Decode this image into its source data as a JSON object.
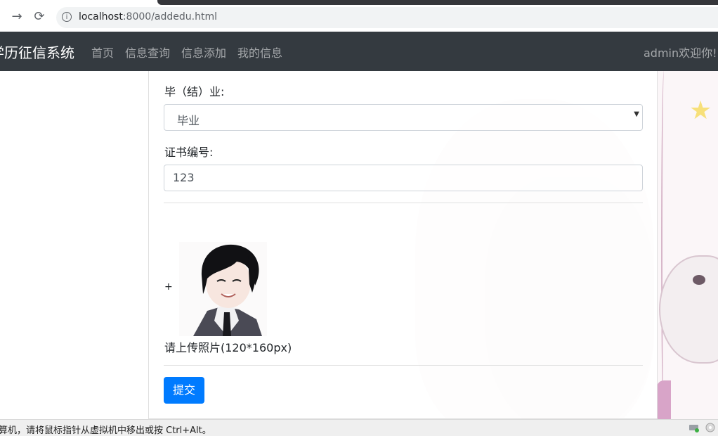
{
  "browser": {
    "url_host": "localhost",
    "url_path": ":8000/addedu.html",
    "back_icon": "arrow-right-icon",
    "reload_icon": "reload-icon"
  },
  "navbar": {
    "brand": "学历征信系统",
    "links": [
      "首页",
      "信息查询",
      "信息添加",
      "我的信息"
    ],
    "welcome": "admin欢迎你! 退"
  },
  "form": {
    "graduation_label": "毕（结）业:",
    "graduation_value": "毕业",
    "cert_label": "证书编号:",
    "cert_value": "123",
    "plus": "+",
    "upload_hint": "请上传照片(120*160px)",
    "submit": "提交"
  },
  "status": {
    "text": "算机，请将鼠标指针从虚拟机中移出或按 Ctrl+Alt。"
  },
  "colors": {
    "navbar_bg": "#343a40",
    "primary": "#007bff"
  }
}
